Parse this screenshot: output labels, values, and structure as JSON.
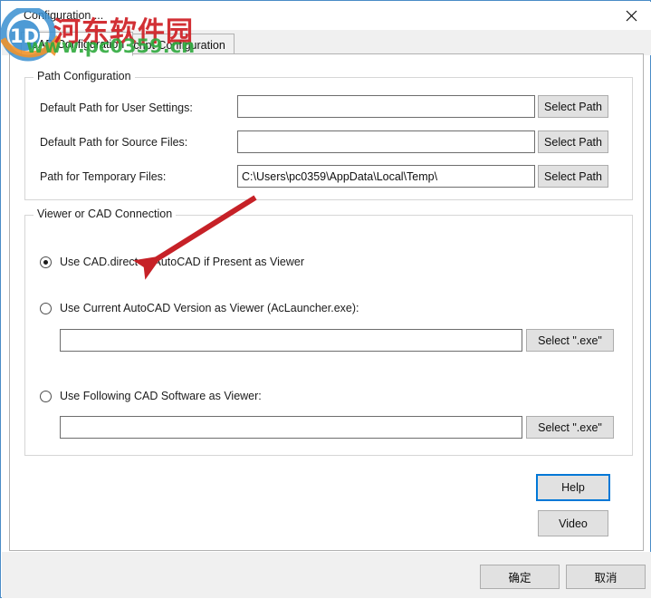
{
  "window": {
    "title": "Configuration ...",
    "close_icon": "close-icon"
  },
  "tabs": [
    {
      "label": "CAD Configuration",
      "selected": true
    },
    {
      "label": "Script Configuration",
      "selected": false
    }
  ],
  "path_group": {
    "title": "Path Configuration",
    "rows": [
      {
        "label": "Default Path for User Settings:",
        "value": "",
        "placeholder": "",
        "button": "Select Path"
      },
      {
        "label": "Default Path for Source Files:",
        "value": "",
        "placeholder": "",
        "button": "Select Path"
      },
      {
        "label": "Path for Temporary Files:",
        "value": "C:\\Users\\pc0359\\AppData\\Local\\Temp\\",
        "placeholder": "",
        "button": "Select Path"
      }
    ]
  },
  "viewer_group": {
    "title": "Viewer or CAD Connection",
    "options": [
      {
        "label": "Use CAD.direct or AutoCAD if Present as Viewer",
        "checked": true
      },
      {
        "label": "Use Current AutoCAD Version as Viewer (AcLauncher.exe):",
        "checked": false
      },
      {
        "label": "Use Following CAD Software as Viewer:",
        "checked": false
      }
    ],
    "aclauncher_input": {
      "value": "",
      "button": "Select \".exe\""
    },
    "cadsoftware_input": {
      "value": "",
      "button": "Select \".exe\""
    }
  },
  "side_buttons": {
    "help": "Help",
    "video": "Video"
  },
  "footer": {
    "ok": "确定",
    "cancel": "取消"
  },
  "watermark": {
    "chinese": "河东软件园",
    "url": "www.pc0359.cn"
  },
  "colors": {
    "window_border": "#4a8cc7",
    "focus_blue": "#0078d7",
    "annotation_red": "#c62127",
    "watermark_red": "#cf1f24",
    "watermark_green": "#2faa3e",
    "button_face": "#e1e1e1",
    "panel_gray": "#f0f0f0"
  }
}
